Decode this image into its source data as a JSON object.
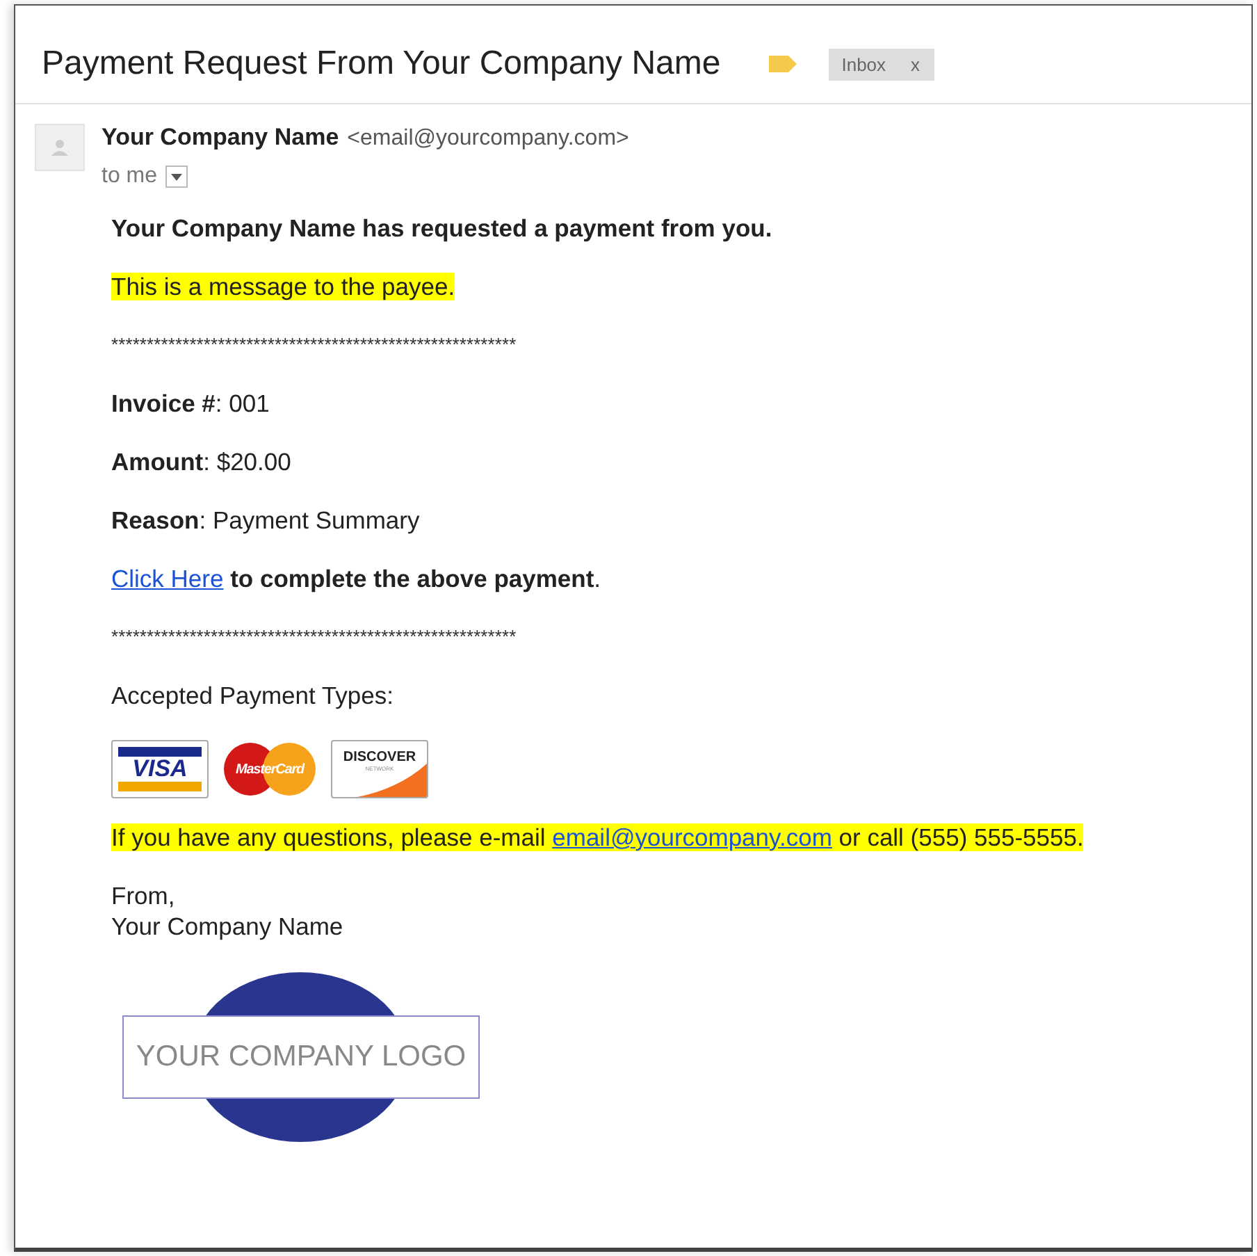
{
  "subject": "Payment Request From Your Company Name",
  "label_tag": {
    "text": "Inbox",
    "close": "x"
  },
  "sender": {
    "name": "Your Company Name",
    "email": "<email@yourcompany.com>",
    "recipient": "to me"
  },
  "body": {
    "heading": "Your Company Name has requested a payment from you.",
    "message": "This is a message to the payee.",
    "separator": "*********************************************************",
    "fields": [
      {
        "label": "Invoice #",
        "value": ": 001"
      },
      {
        "label": "Amount",
        "value": ": $20.00"
      },
      {
        "label": "Reason",
        "value": ": Payment Summary"
      }
    ],
    "cta": {
      "link": "Click Here",
      "text": " to complete the above payment",
      "end": "."
    },
    "separator_2": "*********************************************************",
    "accepted": "Accepted Payment Types:",
    "cards": [
      {
        "kind": "visa",
        "text": "VISA"
      },
      {
        "kind": "mastercard",
        "text": "MasterCard"
      },
      {
        "kind": "discover",
        "text": "DISCOVER",
        "sub": "NETWORK"
      }
    ],
    "questions": {
      "before": "If you have any questions, please e-mail ",
      "link": "email@yourcompany.com",
      "after": " or call (555) 555-5555."
    },
    "closing": "From,",
    "signature": "Your Company Name",
    "logo": "YOUR COMPANY LOGO"
  }
}
